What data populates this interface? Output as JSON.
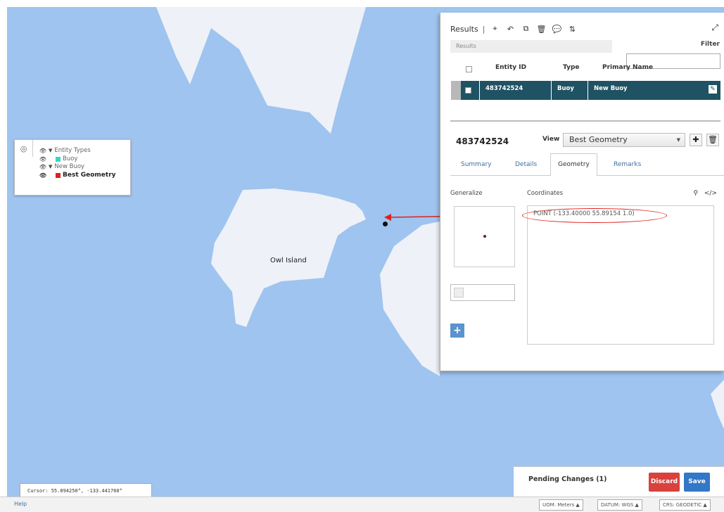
{
  "map": {
    "island_label": "Owl Island",
    "cursor": "Cursor: 55.894250°, -133.441760°"
  },
  "layers": {
    "items": [
      {
        "label": "Entity Types",
        "swatch": null
      },
      {
        "label": "Buoy",
        "swatch": "#35d6c5"
      },
      {
        "label": "New Buoy",
        "swatch": null
      },
      {
        "label": "Best Geometry",
        "swatch": "#e0201c"
      }
    ]
  },
  "results": {
    "title": "Results",
    "subheader": "Results",
    "filter_label": "Filter",
    "columns": [
      "Entity ID",
      "Type",
      "Primary Name"
    ],
    "rows": [
      {
        "entity_id": "483742524",
        "type": "Buoy",
        "primary_name": "New Buoy"
      }
    ]
  },
  "entity": {
    "id": "483742524",
    "view_label": "View",
    "view_value": "Best Geometry",
    "tabs": [
      "Summary",
      "Details",
      "Geometry",
      "Remarks"
    ],
    "active_tab": "Geometry",
    "generalize_label": "Generalize",
    "coordinates_label": "Coordinates",
    "coordinates_value": "POINT (-133.40000 55.89154 1.0)"
  },
  "pending": {
    "title": "Pending Changes (1)",
    "discard": "Discard",
    "save": "Save"
  },
  "status_bar": {
    "help": "Help",
    "uom": "UOM: Meters ▲",
    "datum": "DATUM: WGS ▲",
    "crs": "CRS: GEODETIC ▲"
  },
  "colors": {
    "water": "#9ec4ef",
    "land": "#eef1f8",
    "selected_row": "#1f5263",
    "discard": "#d9413d",
    "save": "#3377c7",
    "annotation": "#e0201c"
  }
}
